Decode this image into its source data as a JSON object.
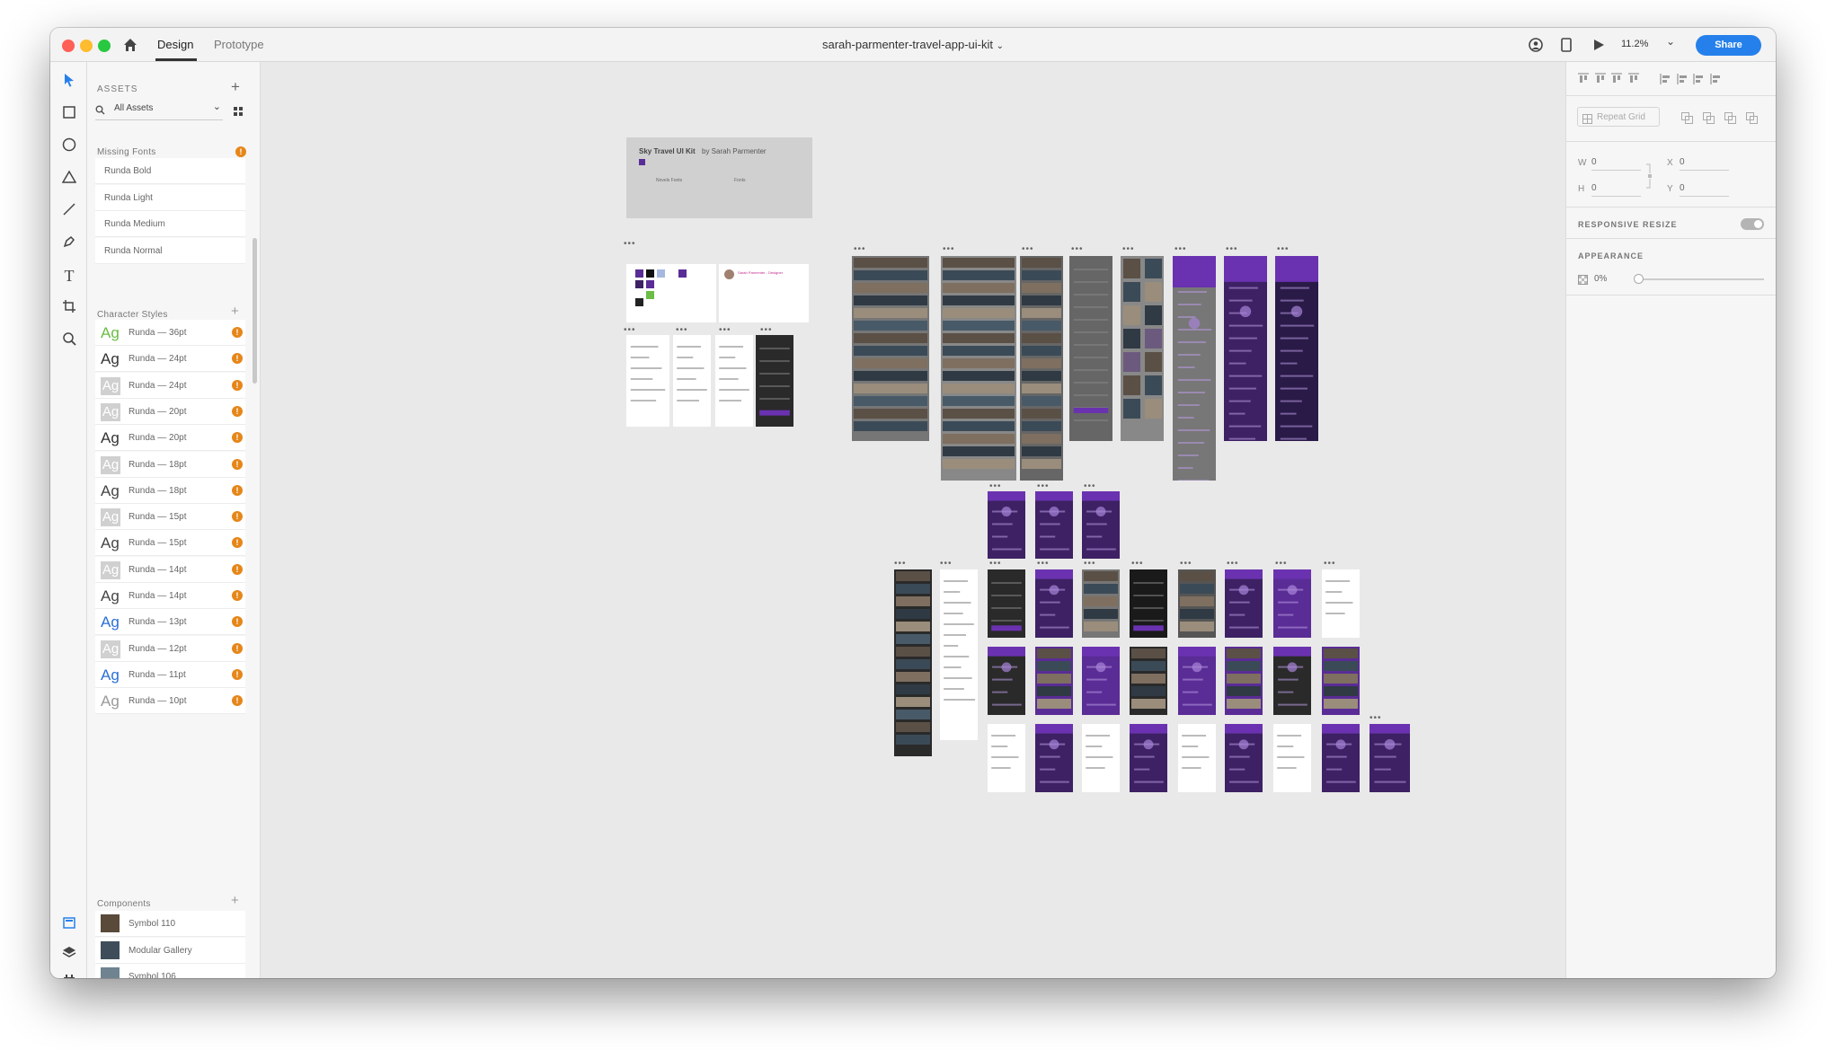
{
  "titlebar": {
    "tabs": {
      "design": "Design",
      "prototype": "Prototype"
    },
    "doc_title": "sarah-parmenter-travel-app-ui-kit",
    "zoom": "11.2%",
    "share": "Share"
  },
  "assets": {
    "header": "ASSETS",
    "filter": "All Assets",
    "missing_fonts": {
      "title": "Missing Fonts",
      "items": [
        "Runda Bold",
        "Runda Light",
        "Runda Medium",
        "Runda Normal"
      ]
    },
    "character_styles": {
      "title": "Character Styles",
      "items": [
        {
          "sample": "Ag",
          "label": "Runda — 36pt"
        },
        {
          "sample": "Ag",
          "label": "Runda — 24pt"
        },
        {
          "sample": "Ag",
          "label": "Runda — 24pt"
        },
        {
          "sample": "Ag",
          "label": "Runda — 20pt"
        },
        {
          "sample": "Ag",
          "label": "Runda — 20pt"
        },
        {
          "sample": "Ag",
          "label": "Runda — 18pt"
        },
        {
          "sample": "Ag",
          "label": "Runda — 18pt"
        },
        {
          "sample": "Ag",
          "label": "Runda — 15pt"
        },
        {
          "sample": "Ag",
          "label": "Runda — 15pt"
        },
        {
          "sample": "Ag",
          "label": "Runda — 14pt"
        },
        {
          "sample": "Ag",
          "label": "Runda — 14pt"
        },
        {
          "sample": "Ag",
          "label": "Runda — 13pt"
        },
        {
          "sample": "Ag",
          "label": "Runda — 12pt"
        },
        {
          "sample": "Ag",
          "label": "Runda — 11pt"
        },
        {
          "sample": "Ag",
          "label": "Runda — 10pt"
        }
      ]
    },
    "components": {
      "title": "Components",
      "items": [
        "Symbol 110",
        "Modular Gallery",
        "Symbol 106"
      ]
    }
  },
  "canvas": {
    "cover": {
      "title": "Sky Travel UI Kit",
      "byline": "by Sarah Parmenter",
      "section_a": "Novels Fonts",
      "section_b": "Fonts"
    },
    "card_author": "Sarah Parmenter - Designer"
  },
  "properties": {
    "repeat_grid": "Repeat Grid",
    "w_label": "W",
    "w_value": "0",
    "h_label": "H",
    "h_value": "0",
    "x_label": "X",
    "x_value": "0",
    "y_label": "Y",
    "y_value": "0",
    "responsive_resize": "RESPONSIVE RESIZE",
    "appearance": "APPEARANCE",
    "opacity": "0%"
  },
  "colors": {
    "accent": "#2680eb",
    "purple": "#4a1a8c",
    "warning": "#e68619"
  }
}
